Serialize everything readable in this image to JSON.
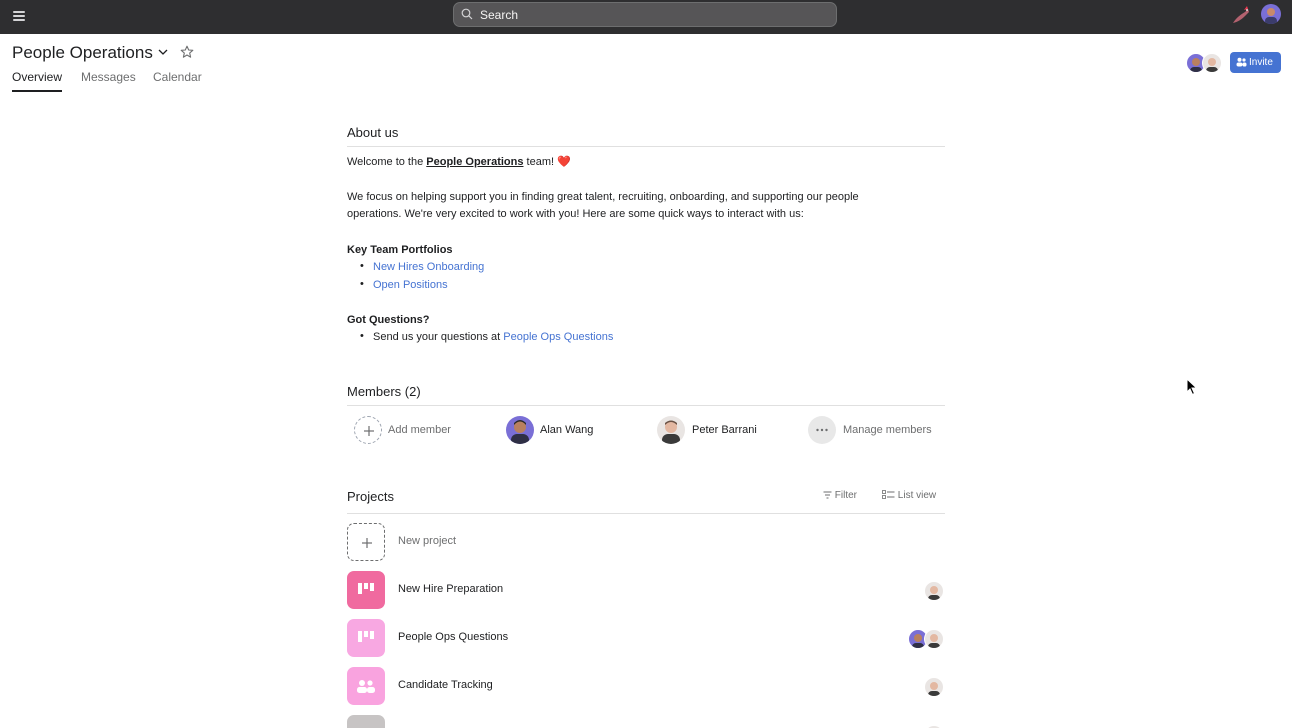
{
  "topbar": {
    "search_placeholder": "Search",
    "icons": [
      "menu-icon",
      "search-icon",
      "bird-logo-icon",
      "user-avatar-icon"
    ]
  },
  "header": {
    "title": "People Operations",
    "tabs": [
      {
        "label": "Overview",
        "active": true
      },
      {
        "label": "Messages",
        "active": false
      },
      {
        "label": "Calendar",
        "active": false
      }
    ],
    "invite_label": "Invite"
  },
  "about": {
    "heading": "About us",
    "welcome_prefix": "Welcome to the ",
    "welcome_team": "People Operations",
    "welcome_suffix": " team! ",
    "welcome_emoji": "❤️",
    "intro_line1": "We focus on helping support you in finding great talent, recruiting, onboarding, and supporting our people",
    "intro_line2": "operations. We're very excited to work with you! Here are some quick ways to interact with us:",
    "portfolios_heading": "Key Team Portfolios",
    "portfolios": [
      "New Hires Onboarding",
      "Open Positions"
    ],
    "questions_heading": "Got Questions?",
    "questions_prefix": "Send us your questions at ",
    "questions_link": "People Ops Questions",
    "bullet": "•"
  },
  "members": {
    "heading": "Members (2)",
    "add_label": "Add member",
    "people": [
      {
        "name": "Alan Wang"
      },
      {
        "name": "Peter Barrani"
      }
    ],
    "manage_label": "Manage members"
  },
  "projects": {
    "heading": "Projects",
    "filter_label": "Filter",
    "view_label": "List view",
    "new_label": "New project",
    "items": [
      {
        "name": "New Hire Preparation",
        "color": "#f06a9f",
        "icon": "board-icon"
      },
      {
        "name": "People Ops Questions",
        "color": "#f8a8e2",
        "icon": "board-icon"
      },
      {
        "name": "Candidate Tracking",
        "color": "#f9a3df",
        "icon": "people-icon"
      }
    ]
  },
  "colors": {
    "topbar": "#2e2e30",
    "accent": "#4573d2",
    "link": "#4573d2"
  }
}
